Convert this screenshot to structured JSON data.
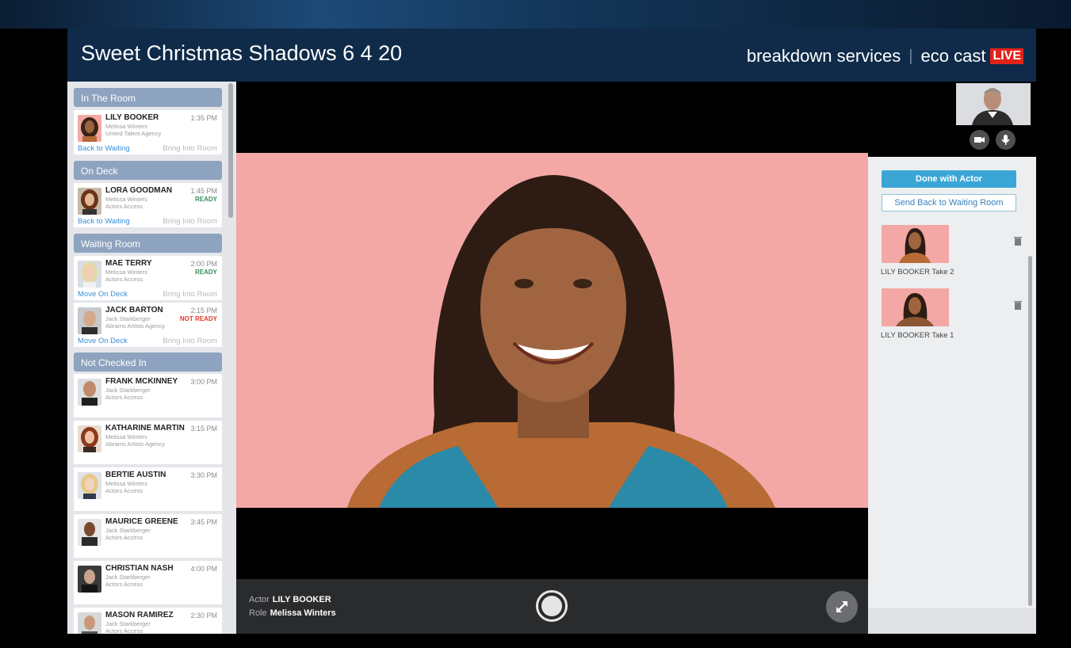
{
  "header": {
    "title": "Sweet Christmas Shadows 6 4 20",
    "brand_left": "breakdown services",
    "brand_sep": "|",
    "brand_right": "eco cast",
    "live_badge": "LIVE"
  },
  "sidebar": {
    "sections": {
      "in_room": "In The Room",
      "on_deck": "On Deck",
      "waiting": "Waiting Room",
      "not_checked": "Not Checked In"
    },
    "in_room": [
      {
        "name": "LILY BOOKER",
        "time": "1:35 PM",
        "role": "Melissa Winters",
        "agency": "United Talent Agency",
        "status": "",
        "action_left": "Back to Waiting",
        "action_right": "Bring Into Room"
      }
    ],
    "on_deck": [
      {
        "name": "LORA GOODMAN",
        "time": "1:45 PM",
        "role": "Melissa Winters",
        "agency": "Actors Access",
        "status": "READY",
        "action_left": "Back to Waiting",
        "action_right": "Bring Into Room"
      }
    ],
    "waiting": [
      {
        "name": "MAE TERRY",
        "time": "2:00 PM",
        "role": "Melissa Winters",
        "agency": "Actors Access",
        "status": "READY",
        "action_left": "Move On Deck",
        "action_right": "Bring Into Room"
      },
      {
        "name": "JACK BARTON",
        "time": "2:15 PM",
        "role": "Jack Starkberger",
        "agency": "Abrams Artists Agency",
        "status": "NOT READY",
        "action_left": "Move On Deck",
        "action_right": "Bring Into Room"
      }
    ],
    "not_checked": [
      {
        "name": "FRANK MCKINNEY",
        "time": "3:00 PM",
        "role": "Jack Starkberger",
        "agency": "Actors Access"
      },
      {
        "name": "KATHARINE MARTIN",
        "time": "3:15 PM",
        "role": "Melissa Winters",
        "agency": "Abrams Artists Agency"
      },
      {
        "name": "BERTIE AUSTIN",
        "time": "3:30 PM",
        "role": "Melissa Winters",
        "agency": "Actors Access"
      },
      {
        "name": "MAURICE GREENE",
        "time": "3:45 PM",
        "role": "Jack Starkberger",
        "agency": "Actors Access"
      },
      {
        "name": "CHRISTIAN NASH",
        "time": "4:00 PM",
        "role": "Jack Starkberger",
        "agency": "Actors Access"
      },
      {
        "name": "MASON RAMIREZ",
        "time": "2:30 PM",
        "role": "Jack Starkberger",
        "agency": "Actors Access"
      }
    ]
  },
  "controls": {
    "actor_label": "Actor",
    "actor_name": "LILY BOOKER",
    "role_label": "Role",
    "role_name": "Melissa Winters"
  },
  "right_panel": {
    "done_label": "Done with Actor",
    "send_back_label": "Send Back to Waiting Room",
    "takes": [
      {
        "label": "LILY BOOKER Take 2"
      },
      {
        "label": "LILY BOOKER Take 1"
      }
    ]
  },
  "colors": {
    "header_bg": "#0f2b49",
    "section_header": "#8ea3bf",
    "link_blue": "#3b8fd8",
    "ready_green": "#3a8f5a",
    "not_ready_red": "#e0392b",
    "live_red": "#e2231a",
    "done_button": "#3ba6d6",
    "video_bg": "#f3a8a6"
  },
  "icons": [
    "video-camera-icon",
    "microphone-icon",
    "record-button-icon",
    "expand-icon",
    "trash-icon"
  ]
}
